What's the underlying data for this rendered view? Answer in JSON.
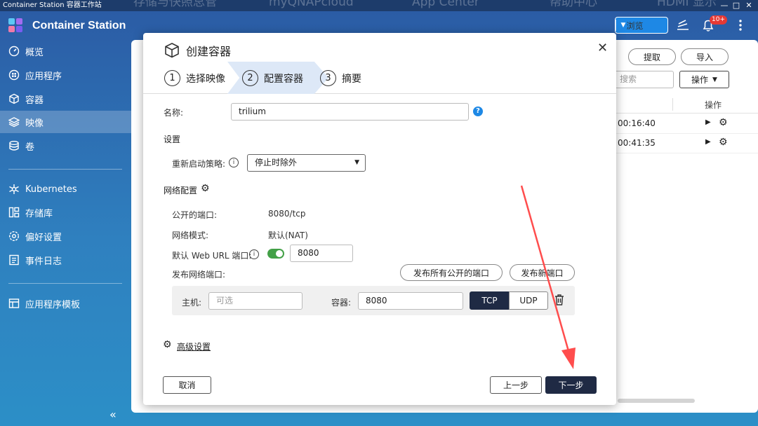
{
  "window": {
    "title": "Container Station 容器工作站",
    "ghost_tabs": [
      "存储与快照总管",
      "myQNAPcloud",
      "App Center",
      "帮助中心",
      "HDMI 显示"
    ]
  },
  "sidebar": {
    "brand": "Container Station",
    "items": [
      {
        "label": "概览",
        "icon": "overview-icon"
      },
      {
        "label": "应用程序",
        "icon": "apps-icon"
      },
      {
        "label": "容器",
        "icon": "container-icon"
      },
      {
        "label": "映像",
        "icon": "images-icon",
        "active": true
      },
      {
        "label": "卷",
        "icon": "volume-icon"
      },
      {
        "label": "Kubernetes",
        "icon": "kubernetes-icon"
      },
      {
        "label": "存储库",
        "icon": "registry-icon"
      },
      {
        "label": "偏好设置",
        "icon": "preferences-icon"
      },
      {
        "label": "事件日志",
        "icon": "event-log-icon"
      },
      {
        "label": "应用程序模板",
        "icon": "app-template-icon"
      }
    ],
    "collapse_glyph": "«"
  },
  "header": {
    "browse_label": "浏览",
    "notification_badge": "10+"
  },
  "background_panel": {
    "pull_label": "提取",
    "import_label": "导入",
    "search_placeholder": "搜索",
    "actions_label": "操作",
    "column_actions": "操作",
    "rows": [
      {
        "time": "00:16:40"
      },
      {
        "time": "00:41:35"
      }
    ]
  },
  "dialog": {
    "title": "创建容器",
    "steps": [
      {
        "num": "1",
        "label": "选择映像"
      },
      {
        "num": "2",
        "label": "配置容器",
        "active": true
      },
      {
        "num": "3",
        "label": "摘要"
      }
    ],
    "name_label": "名称:",
    "name_value": "trilium",
    "settings_heading": "设置",
    "restart_label": "重新启动策略:",
    "restart_value": "停止时除外",
    "network_heading": "网络配置",
    "public_ports_label": "公开的端口:",
    "public_ports_value": "8080/tcp",
    "network_mode_label": "网络模式:",
    "network_mode_value": "默认(NAT)",
    "web_url_port_label": "默认 Web URL 端口:",
    "web_url_port_enabled": true,
    "web_url_port_value": "8080",
    "publish_ports_label": "发布网络端口:",
    "publish_all_label": "发布所有公开的端口",
    "publish_new_label": "发布新端口",
    "port_mapping": {
      "host_label": "主机:",
      "host_placeholder": "可选",
      "container_label": "容器:",
      "container_value": "8080",
      "protocols": [
        "TCP",
        "UDP"
      ],
      "selected_protocol": "TCP"
    },
    "advanced_label": "高级设置",
    "cancel_label": "取消",
    "back_label": "上一步",
    "next_label": "下一步"
  },
  "colors": {
    "primary_dark": "#1f2a44",
    "accent_blue": "#1e88e5",
    "toggle_green": "#43a047",
    "annotation_red": "#ff4d4d",
    "step_active_bg": "#dde8f7"
  }
}
